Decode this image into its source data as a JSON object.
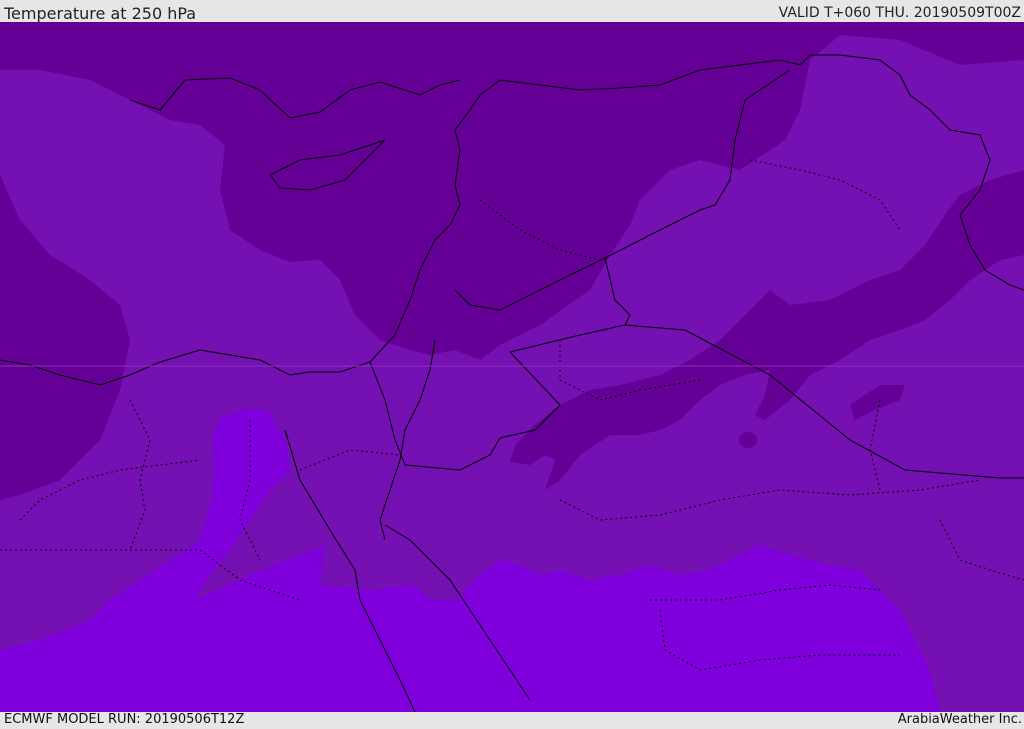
{
  "header": {
    "title": "Temperature at 250 hPa",
    "valid": "VALID T+060 THU. 20190509T00Z"
  },
  "footer": {
    "model_run": "ECMWF MODEL RUN: 20190506T12Z",
    "brand": "ArabiaWeather Inc."
  },
  "colors": {
    "cold": "#650096",
    "mid": "#7510b2",
    "warm": "#8000dd",
    "border": "#000000",
    "frame": "#e6e6e6"
  }
}
